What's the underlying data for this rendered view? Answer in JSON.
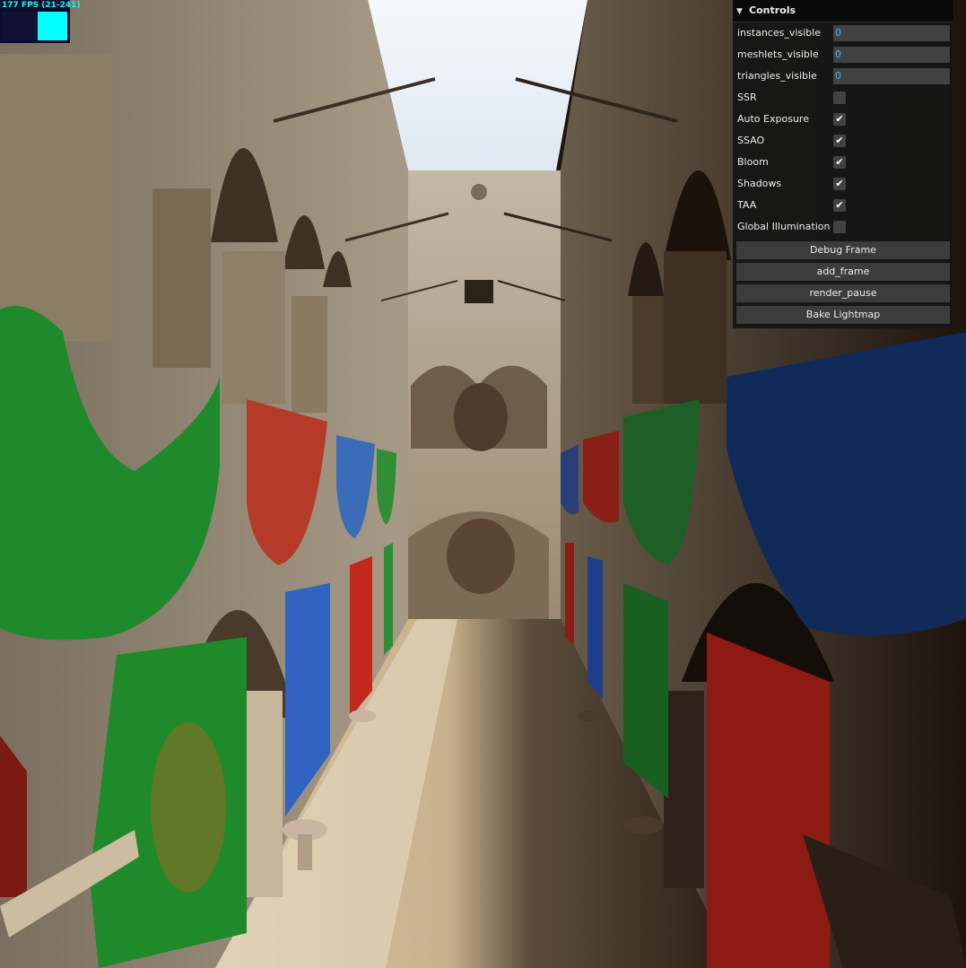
{
  "stats": {
    "fps_label": "177 FPS (21-241)",
    "fps_fraction": 0.45
  },
  "controls": {
    "title": "Controls",
    "toggle_icon": "chevron-down-icon",
    "numbers": [
      {
        "label": "instances_visible",
        "value": "0"
      },
      {
        "label": "meshlets_visible",
        "value": "0"
      },
      {
        "label": "triangles_visible",
        "value": "0"
      }
    ],
    "checkboxes": [
      {
        "label": "SSR",
        "checked": false
      },
      {
        "label": "Auto Exposure",
        "checked": true
      },
      {
        "label": "SSAO",
        "checked": true
      },
      {
        "label": "Bloom",
        "checked": true
      },
      {
        "label": "Shadows",
        "checked": true
      },
      {
        "label": "TAA",
        "checked": true
      },
      {
        "label": "Global Illumination",
        "checked": false
      }
    ],
    "buttons": [
      {
        "label": "Debug Frame"
      },
      {
        "label": "add_frame"
      },
      {
        "label": "render_pause"
      },
      {
        "label": "Bake Lightmap"
      }
    ],
    "check_glyph": "✔"
  }
}
